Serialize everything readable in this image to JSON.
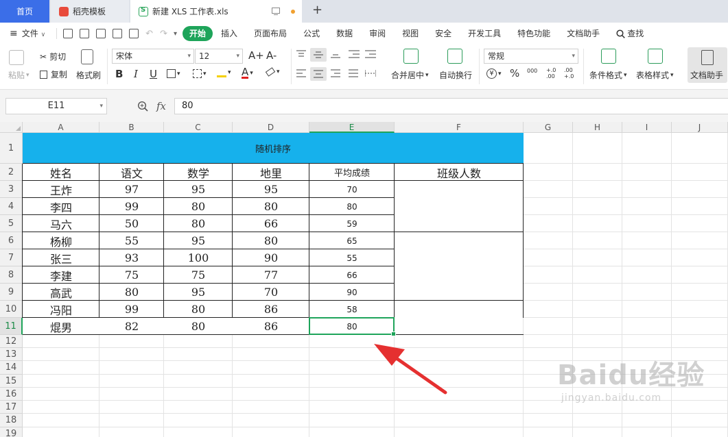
{
  "tabs": {
    "home": "首页",
    "template": "稻壳模板",
    "document": "新建 XLS 工作表.xls",
    "new_tab": "+"
  },
  "menu": {
    "file": "文件",
    "items": [
      "开始",
      "插入",
      "页面布局",
      "公式",
      "数据",
      "审阅",
      "视图",
      "安全",
      "开发工具",
      "特色功能",
      "文档助手"
    ],
    "search": "查找"
  },
  "ribbon": {
    "paste": "粘贴",
    "cut": "剪切",
    "copy": "复制",
    "format_painter": "格式刷",
    "font_name": "宋体",
    "font_size": "12",
    "number_format": "常规",
    "merge_center": "合并居中",
    "wrap_text": "自动换行",
    "conditional_format": "条件格式",
    "table_style": "表格样式",
    "doc_helper": "文档助手",
    "percent": "%",
    "comma": "000",
    "inc_decimal": "+.0 .00",
    "dec_decimal": ".00 +.0",
    "font_increase": "A+",
    "font_decrease": "A-",
    "bold": "B",
    "italic": "I",
    "underline": "U",
    "font_color": "A"
  },
  "formula_bar": {
    "cell_ref": "E11",
    "fx": "fx",
    "value": "80"
  },
  "sheet": {
    "columns": [
      "A",
      "B",
      "C",
      "D",
      "E",
      "F",
      "G",
      "H",
      "I",
      "J"
    ],
    "rows": [
      "1",
      "2",
      "3",
      "4",
      "5",
      "6",
      "7",
      "8",
      "9",
      "10",
      "11",
      "12",
      "13",
      "14",
      "15",
      "16",
      "17",
      "18",
      "19"
    ],
    "title": "随机排序",
    "headers": [
      "姓名",
      "语文",
      "数学",
      "地里",
      "平均成绩",
      "班级人数"
    ],
    "data": [
      [
        "王炸",
        "97",
        "95",
        "95",
        "70"
      ],
      [
        "李四",
        "99",
        "80",
        "80",
        "80"
      ],
      [
        "马六",
        "50",
        "80",
        "66",
        "59"
      ],
      [
        "杨柳",
        "55",
        "95",
        "80",
        "65"
      ],
      [
        "张三",
        "93",
        "100",
        "90",
        "55"
      ],
      [
        "李建",
        "75",
        "75",
        "77",
        "66"
      ],
      [
        "高武",
        "80",
        "95",
        "70",
        "90"
      ],
      [
        "冯阳",
        "99",
        "80",
        "86",
        "58"
      ],
      [
        "焜男",
        "82",
        "80",
        "86",
        "80"
      ]
    ],
    "selected_cell": "E11"
  },
  "watermark": {
    "brand": "Baidu经验",
    "url": "jingyan.baidu.com"
  }
}
